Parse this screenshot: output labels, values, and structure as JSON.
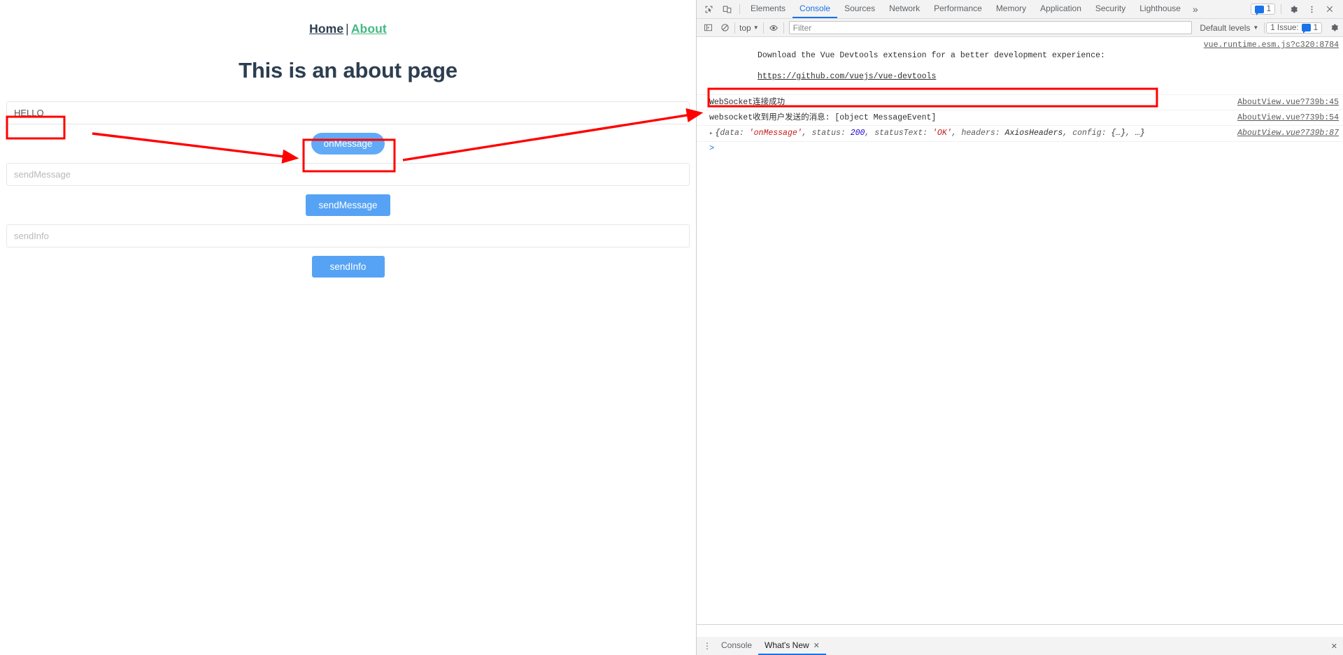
{
  "page": {
    "nav": {
      "home": "Home",
      "separator": "|",
      "about": "About",
      "home_color": "#2c3e50",
      "about_color": "#42b983"
    },
    "title": "This is an about page",
    "fields": [
      {
        "name": "message-input",
        "value": "HELLO",
        "placeholder": ""
      },
      {
        "name": "sendmessage-input",
        "value": "",
        "placeholder": "sendMessage"
      },
      {
        "name": "sendinfo-input",
        "value": "",
        "placeholder": "sendInfo"
      }
    ],
    "buttons": [
      {
        "name": "onmessage-button",
        "label": "onMessage"
      },
      {
        "name": "sendmessage-button",
        "label": "sendMessage"
      },
      {
        "name": "sendinfo-button",
        "label": "sendInfo"
      }
    ],
    "accent_color": "#56a3f5"
  },
  "devtools": {
    "tabs": [
      "Elements",
      "Console",
      "Sources",
      "Network",
      "Performance",
      "Memory",
      "Application",
      "Security",
      "Lighthouse"
    ],
    "active_tab": "Console",
    "more_tabs_glyph": "»",
    "issues": {
      "label": "1 Issue:",
      "count": "1"
    },
    "toolbar_icons": [
      "inspect-element-icon",
      "device-toolbar-icon",
      "settings-gear-icon",
      "more-options-icon",
      "close-devtools-icon"
    ],
    "filterbar": {
      "sidebar_toggle": "console-sidebar-icon",
      "clear": "clear-console-icon",
      "context": "top",
      "eye": "live-expression-icon",
      "filter_placeholder": "Filter",
      "filter_value": "",
      "levels": "Default levels",
      "gear": "console-settings-icon"
    },
    "console_rows": [
      {
        "id": "vue-devtools-hint",
        "line1": "Download the Vue Devtools extension for a better development experience:",
        "line2": "https://github.com/vuejs/vue-devtools",
        "source": "vue.runtime.esm.js?c320:8784",
        "kind": "info"
      },
      {
        "id": "websocket-connected",
        "line1": "WebSocket连接成功",
        "source": "AboutView.vue?739b:45",
        "kind": "log"
      },
      {
        "id": "websocket-received",
        "line1": "websocket收到用户发送的消息: [object MessageEvent]",
        "source": "AboutView.vue?739b:54",
        "kind": "log"
      }
    ],
    "axios_row": {
      "id": "axios-response-object",
      "disclosure": "▸",
      "open_brace": "{",
      "parts": [
        {
          "key": "data: ",
          "value": "'onMessage'",
          "type": "string"
        },
        {
          "key": ", status: ",
          "value": "200",
          "type": "number"
        },
        {
          "key": ", statusText: ",
          "value": "'OK'",
          "type": "string"
        },
        {
          "key": ", headers: ",
          "value": "AxiosHeaders",
          "type": "class"
        },
        {
          "key": ", config: ",
          "value": "{…}",
          "type": "class"
        },
        {
          "key": ", ",
          "value": "…",
          "type": "class"
        }
      ],
      "close_brace": "}",
      "source": "AboutView.vue?739b:87"
    },
    "prompt": ">",
    "drawer": {
      "tabs": [
        {
          "label": "Console",
          "active": false,
          "closable": false
        },
        {
          "label": "What's New",
          "active": true,
          "closable": true
        }
      ],
      "close_glyph": "✕",
      "dots_glyph": "⋮",
      "drawer_close": "✕"
    }
  },
  "annotations": {
    "highlight_color": "#ff0000",
    "boxes": [
      "message-input-highlight",
      "onmessage-button-highlight",
      "console-object-highlight"
    ],
    "arrows": [
      "input-to-button-arrow",
      "button-to-console-arrow"
    ]
  }
}
